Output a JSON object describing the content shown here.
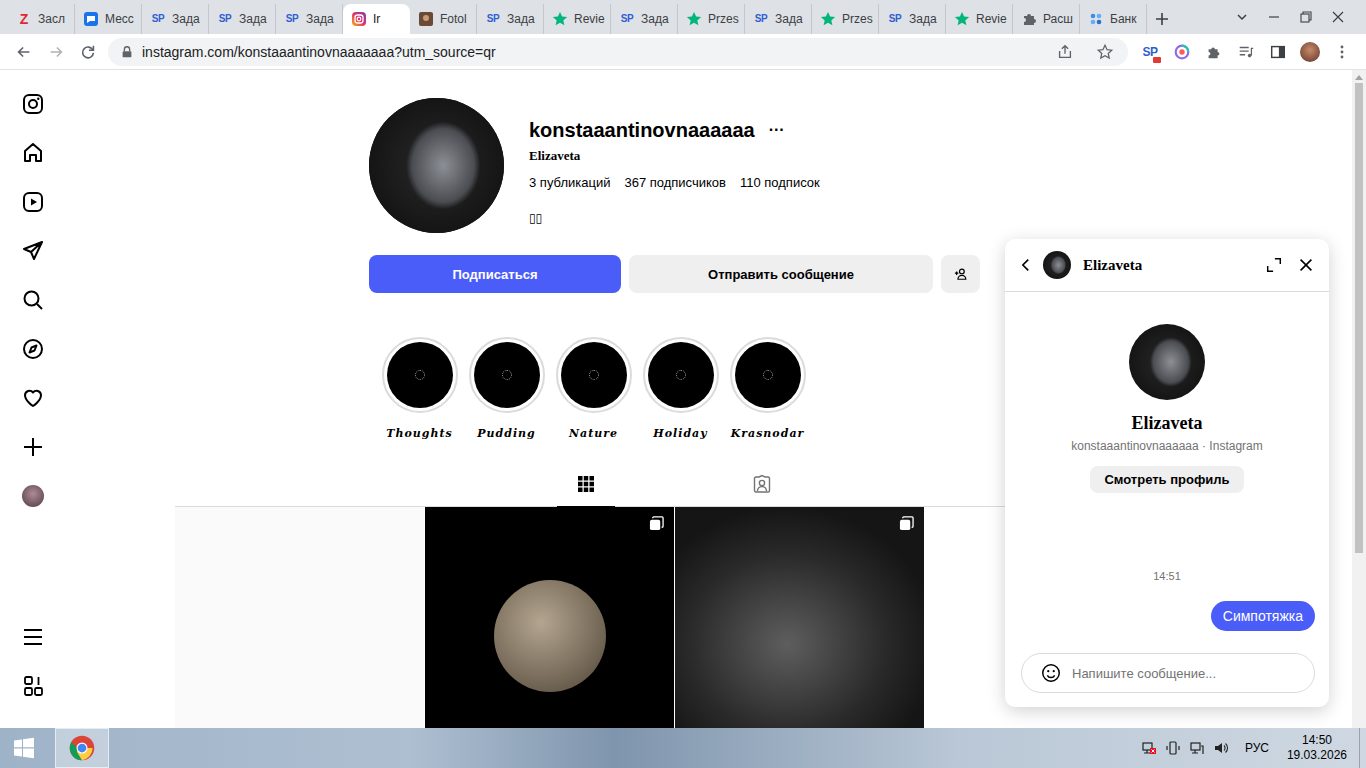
{
  "browser": {
    "tabs": [
      {
        "label": "Засл",
        "kind": "z",
        "glyph": "Z",
        "selected": false
      },
      {
        "label": "Месс",
        "kind": "chat",
        "selected": false
      },
      {
        "label": "Зада",
        "kind": "sp",
        "glyph": "SP",
        "selected": false
      },
      {
        "label": "Зада",
        "kind": "sp",
        "glyph": "SP",
        "selected": false
      },
      {
        "label": "Зада",
        "kind": "sp",
        "glyph": "SP",
        "selected": false
      },
      {
        "label": "Ir",
        "kind": "instagram",
        "selected": true
      },
      {
        "label": "Fotol",
        "kind": "photo",
        "selected": false
      },
      {
        "label": "Зада",
        "kind": "sp",
        "glyph": "SP",
        "selected": false
      },
      {
        "label": "Revie",
        "kind": "star",
        "selected": false
      },
      {
        "label": "Зада",
        "kind": "sp",
        "glyph": "SP",
        "selected": false
      },
      {
        "label": "Przes",
        "kind": "star",
        "selected": false
      },
      {
        "label": "Зада",
        "kind": "sp",
        "glyph": "SP",
        "selected": false
      },
      {
        "label": "Przes",
        "kind": "star",
        "selected": false
      },
      {
        "label": "Зада",
        "kind": "sp",
        "glyph": "SP",
        "selected": false
      },
      {
        "label": "Revie",
        "kind": "star",
        "selected": false
      },
      {
        "label": "Расш",
        "kind": "puzzle",
        "selected": false
      },
      {
        "label": "Банк",
        "kind": "bank",
        "selected": false
      }
    ],
    "url": "instagram.com/konstaaantinovnaaaaaaa?utm_source=qr",
    "extension_glyph": "SP"
  },
  "profile": {
    "username": "konstaaantinovnaaaaaa",
    "more": "···",
    "name": "Elizaveta",
    "stats": [
      "3 публикаций",
      "367 подписчиков",
      "110 подписок"
    ],
    "bio": "▯▯",
    "follow_button": "Подписаться",
    "message_button": "Отправить сообщение"
  },
  "highlights": [
    {
      "label": "Thoughts"
    },
    {
      "label": "Pudding"
    },
    {
      "label": "Nature"
    },
    {
      "label": "Holiday"
    },
    {
      "label": "Krasnodar"
    }
  ],
  "content_tabs": [
    {
      "kind": "posts",
      "selected": true
    },
    {
      "kind": "tagged",
      "selected": false
    }
  ],
  "posts": [
    {
      "kind": "quote",
      "carousel": false
    },
    {
      "kind": "moon",
      "carousel": true
    },
    {
      "kind": "smoke",
      "carousel": true
    }
  ],
  "chat": {
    "title": "Elizaveta",
    "name": "Elizaveta",
    "subtitle": "konstaaantinovnaaaaaa · Instagram",
    "profile_button": "Смотреть профиль",
    "time": "14:51",
    "messages": [
      {
        "text": "Симпотяжка",
        "outgoing": true
      }
    ],
    "input_placeholder": "Напишите сообщение..."
  },
  "taskbar": {
    "apps": [
      {
        "kind": "chrome",
        "selected": true
      }
    ],
    "language": "РУС",
    "time": "14:50",
    "date": "19.03.2026"
  }
}
